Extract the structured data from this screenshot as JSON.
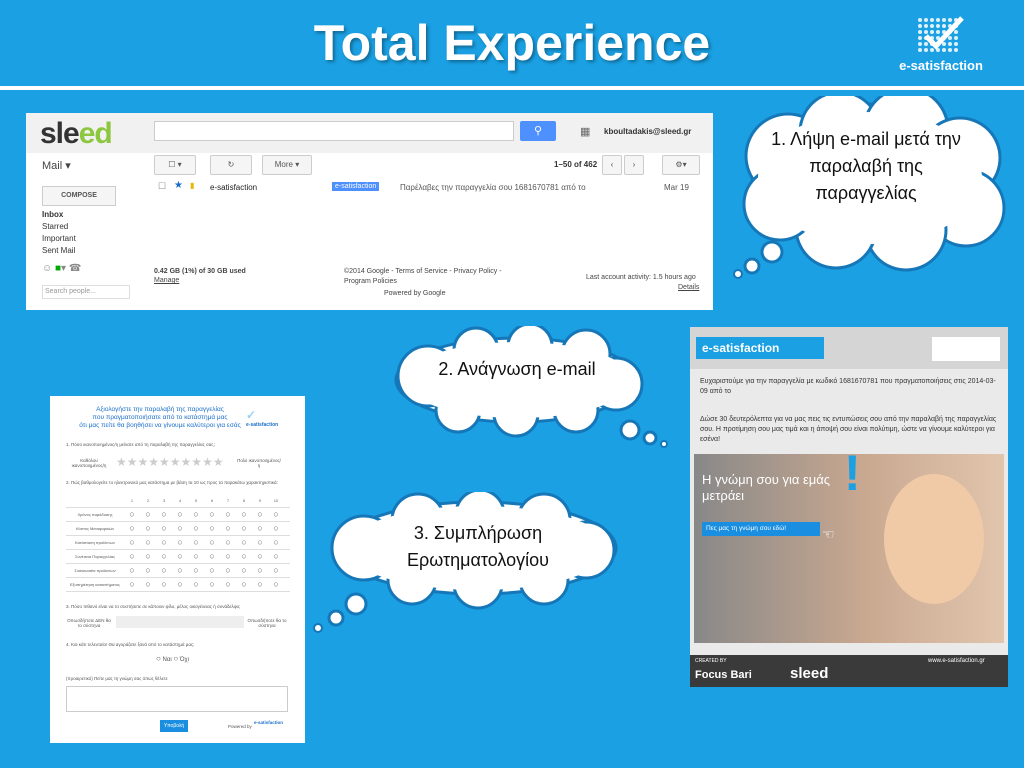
{
  "title": "Total Experience",
  "logo": {
    "text": "e-satisfaction"
  },
  "gmail": {
    "brand_a": "sle",
    "brand_b": "ed",
    "search_icon": "search-icon",
    "account": "kboultadakis@sleed.gr",
    "mail_label": "Mail ▾",
    "more_label": "More ▾",
    "pager": "1–50 of 462",
    "compose": "COMPOSE",
    "nav": [
      "Inbox",
      "Starred",
      "Important",
      "Sent Mail"
    ],
    "search_people": "Search people...",
    "message": {
      "sender": "e-satisfaction",
      "tag": "e-satisfaction",
      "subject": "Παρέλαβες την παραγγελία σου 1681670781 από το",
      "date": "Mar 19"
    },
    "storage": "0.42 GB (1%) of 30 GB used",
    "manage": "Manage",
    "copyright": "©2014 Google - Terms of Service - Privacy Policy - Program Policies",
    "powered": "Powered by Google",
    "activity": "Last account activity: 1.5 hours ago",
    "details": "Details"
  },
  "clouds": {
    "c1": "1. Λήψη e-mail μετά την παραλαβή της παραγγελίας",
    "c2": "2.  Ανάγνωση e-mail",
    "c3": "3. Συμπλήρωση Ερωτηματολογίου"
  },
  "survey": {
    "title1": "Αξιολογήστε την παραλαβή της παραγγελίας",
    "title2": "που πραγματοποιήσατε από το κατάστημά μας",
    "title3": "ότι μας πείτε θα βοηθήσει να γίνουμε καλύτεροι για εσάς",
    "logo": "e-satisfaction",
    "q1": "1. Πόσο ικανοποιημένος/η μείνατε από τη παραλαβή της παραγγελίας σας;",
    "q1_low": "Καθόλου ικανοποιημένος/η",
    "q1_high": "Πολύ ικανοποιημένος/η",
    "q2": "2. Πώς βαθμολογείτε το ηλεκτρονικό μας κατάστημα με βάση τα 10 ως προς τα παρακάτω χαρακτηριστικά:",
    "scale": [
      "1",
      "2",
      "3",
      "4",
      "5",
      "6",
      "7",
      "8",
      "9",
      "10"
    ],
    "rows": [
      "Χρόνος παράδοσης",
      "Κόστος Μεταφορικών",
      "Κατάσταση προϊόντων",
      "Συνέπεια Παραγγελίας",
      "Συσκευασία προϊόντων",
      "Εξυπηρέτηση καταστήματος"
    ],
    "q3": "3. Πόσο πιθανό είναι να το συστήσετε σε κάποιον φίλο, μέλος οικογένειας ή συνάδελφο;",
    "q3_low": "Οπωσδήποτε ΔΕΝ θα το σύστηνα",
    "q3_high": "Οπωσδήποτε θα το σύστηνα",
    "q4": "4. Και κάτι τελευταίο! Θα αγοράζατε ξανά από το κατάστημά μας;",
    "yes": "Ναι",
    "no": "Όχι",
    "q5": "(προαιρετικό) Πείτε μας τη γνώμη σας όπως θέλετε",
    "submit": "Υποβολή",
    "powered": "Powered by"
  },
  "email": {
    "logo": "e-satisfaction",
    "line1": "Ευχαριστούμε για την παραγγελία με κωδικό 1681670781 που πραγματοποιήσεις στις 2014-03-09 από το",
    "line2": "Δώσε 30 δευτερόλεπτα για να μας πεις τις εντυπώσεις σου από την παραλαβή της παραγγελίας σου. Η προτίμηση σου μας τιμά και η άποψή σου είναι πολύτιμη, ώστε να γίνουμε καλύτεροι για εσένα!",
    "banner": "Η γνώμη σου για εμάς μετράει",
    "cta": "Πες μας τη γνώμη σου εδώ!",
    "created": "CREATED BY",
    "focus": "Focus Bari",
    "sleed": "sleed",
    "url": "www.e-satisfaction.gr"
  }
}
